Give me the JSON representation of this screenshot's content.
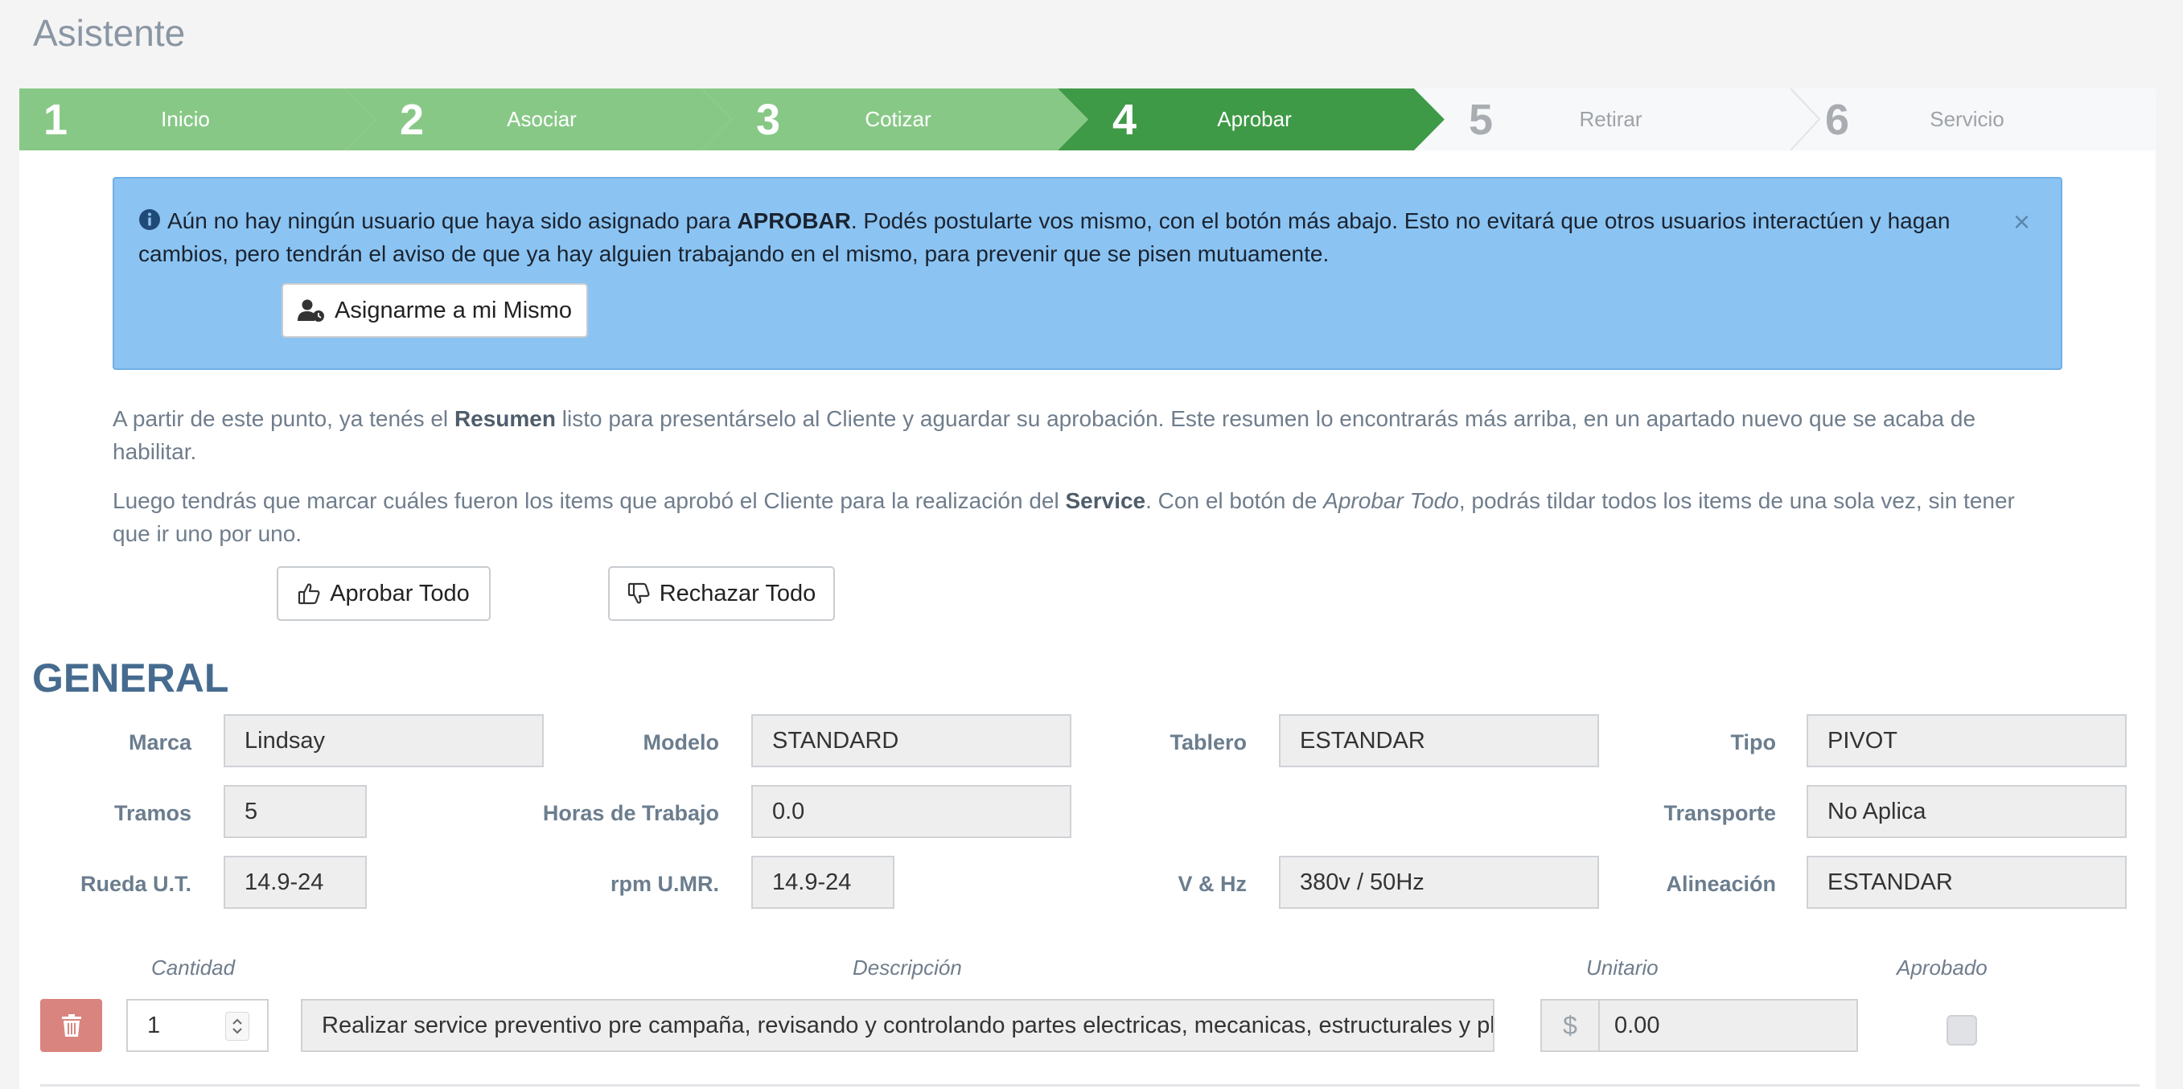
{
  "page": {
    "title": "Asistente"
  },
  "wizard": {
    "steps": [
      {
        "num": "1",
        "label": "Inicio",
        "state": "done"
      },
      {
        "num": "2",
        "label": "Asociar",
        "state": "done"
      },
      {
        "num": "3",
        "label": "Cotizar",
        "state": "done"
      },
      {
        "num": "4",
        "label": "Aprobar",
        "state": "active"
      },
      {
        "num": "5",
        "label": "Retirar",
        "state": "pending"
      },
      {
        "num": "6",
        "label": "Servicio",
        "state": "pending"
      }
    ]
  },
  "alert": {
    "text_before": "Aún no hay ningún usuario que haya sido asignado para ",
    "text_bold": "APROBAR",
    "text_after": ". Podés postularte vos mismo, con el botón más abajo. Esto no evitará que otros usuarios interactúen y hagan cambios, pero tendrán el aviso de que ya hay alguien trabajando en el mismo, para prevenir que se pisen mutuamente.",
    "close_label": "×",
    "assign_button": "Asignarme a mi Mismo"
  },
  "intro": {
    "p1_before": "A partir de este punto, ya tenés el ",
    "p1_bold": "Resumen",
    "p1_after": " listo para presentárselo al Cliente y aguardar su aprobación. Este resumen lo encontrarás más arriba, en un apartado nuevo que se acaba de habilitar.",
    "p2_before": "Luego tendrás que marcar cuáles fueron los items que aprobó el Cliente para la realización del ",
    "p2_bold": "Service",
    "p2_mid": ". Con el botón de ",
    "p2_italic": "Aprobar Todo",
    "p2_after": ", podrás tildar todos los items de una sola vez, sin tener que ir uno por uno.",
    "approve_all": "Aprobar Todo",
    "reject_all": "Rechazar Todo"
  },
  "general": {
    "title": "GENERAL",
    "fields": {
      "marca": {
        "label": "Marca",
        "value": "Lindsay"
      },
      "modelo": {
        "label": "Modelo",
        "value": "STANDARD"
      },
      "tablero": {
        "label": "Tablero",
        "value": "ESTANDAR"
      },
      "tipo": {
        "label": "Tipo",
        "value": "PIVOT"
      },
      "tramos": {
        "label": "Tramos",
        "value": "5"
      },
      "horas": {
        "label": "Horas de Trabajo",
        "value": "0.0"
      },
      "transporte": {
        "label": "Transporte",
        "value": "No Aplica"
      },
      "rueda": {
        "label": "Rueda U.T.",
        "value": "14.9-24"
      },
      "rpm": {
        "label": "rpm U.MR.",
        "value": "14.9-24"
      },
      "vhz": {
        "label": "V & Hz",
        "value": "380v / 50Hz"
      },
      "alineacion": {
        "label": "Alineación",
        "value": "ESTANDAR"
      }
    }
  },
  "items": {
    "headers": {
      "cantidad": "Cantidad",
      "descripcion": "Descripción",
      "unitario": "Unitario",
      "aprobado": "Aprobado"
    },
    "rows": [
      {
        "cantidad": "1",
        "descripcion": "Realizar service preventivo pre campaña, revisando y controlando partes electricas, mecanicas, estructurales y plu",
        "currency": "$",
        "unitario": "0.00",
        "aprobado": false
      }
    ]
  }
}
